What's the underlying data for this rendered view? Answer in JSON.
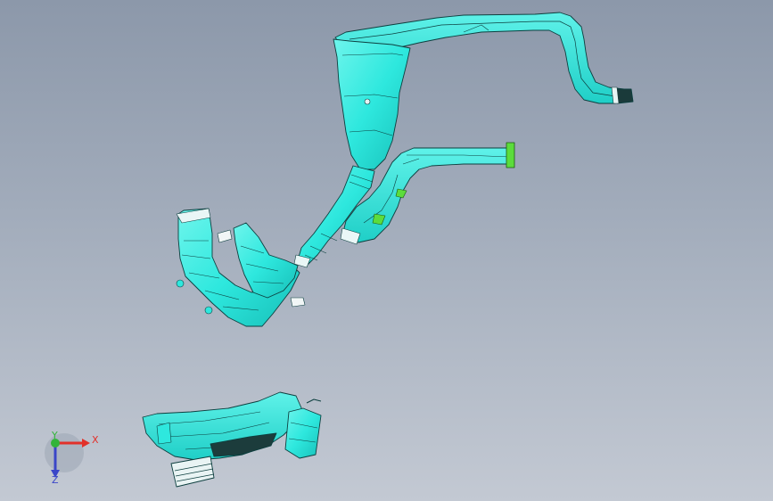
{
  "app": {
    "window_title": ""
  },
  "colors": {
    "background_top": "#8c98aa",
    "background_bottom": "#c3c9d3",
    "part_fill": "#2ee8de",
    "part_fill_light": "#63f3ea",
    "part_fill_dark": "#16b9b3",
    "edge": "#0d3f3f",
    "highlight_green": "#5cdc3c",
    "axis_x": "#e2312a",
    "axis_y": "#33b43a",
    "axis_z": "#3a46c8"
  },
  "triad": {
    "x_label": "X",
    "y_label": "Y",
    "z_label": "Z"
  },
  "scene": {
    "parts": [
      {
        "name": "upper-duct-assembly",
        "icon": "duct-part"
      },
      {
        "name": "long-branch-duct",
        "icon": "duct-part"
      },
      {
        "name": "left-elbow-duct",
        "icon": "duct-part"
      },
      {
        "name": "bottom-duct-assembly",
        "icon": "duct-part"
      }
    ]
  }
}
